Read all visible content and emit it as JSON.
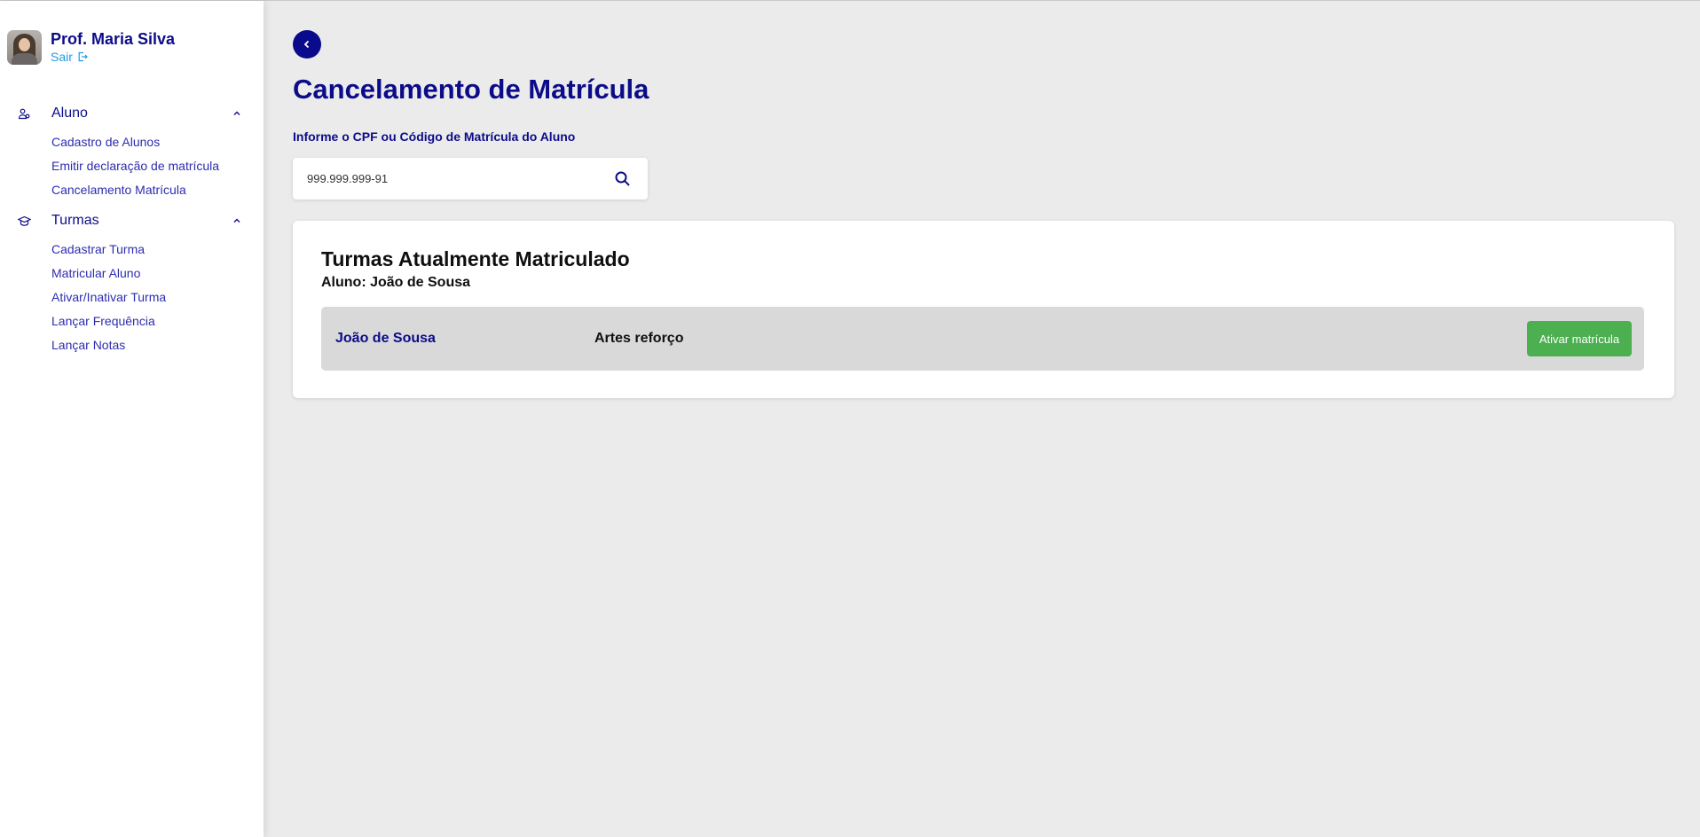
{
  "user": {
    "name": "Prof. Maria Silva",
    "logout_label": "Sair"
  },
  "sidebar": {
    "sections": [
      {
        "label": "Aluno",
        "icon": "users-icon",
        "expanded": true,
        "items": [
          {
            "label": "Cadastro de Alunos"
          },
          {
            "label": "Emitir declaração de matrícula"
          },
          {
            "label": "Cancelamento Matrícula"
          }
        ]
      },
      {
        "label": "Turmas",
        "icon": "graduation-cap-icon",
        "expanded": true,
        "items": [
          {
            "label": "Cadastrar Turma"
          },
          {
            "label": "Matricular Aluno"
          },
          {
            "label": "Ativar/Inativar Turma"
          },
          {
            "label": "Lançar Frequência"
          },
          {
            "label": "Lançar Notas"
          }
        ]
      }
    ]
  },
  "main": {
    "title": "Cancelamento de Matrícula",
    "search": {
      "label": "Informe o CPF ou Código de Matrícula do Aluno",
      "value": "999.999.999-91"
    },
    "card": {
      "title": "Turmas Atualmente Matriculado",
      "subtitle": "Aluno: João de Sousa",
      "enrollments": [
        {
          "student": "João de Sousa",
          "class_name": "Artes reforço",
          "action_label": "Ativar matrícula"
        }
      ]
    }
  },
  "colors": {
    "primary": "#0c0c8a",
    "link": "#1f9ae6",
    "success": "#4caf50",
    "background": "#ebebeb"
  }
}
